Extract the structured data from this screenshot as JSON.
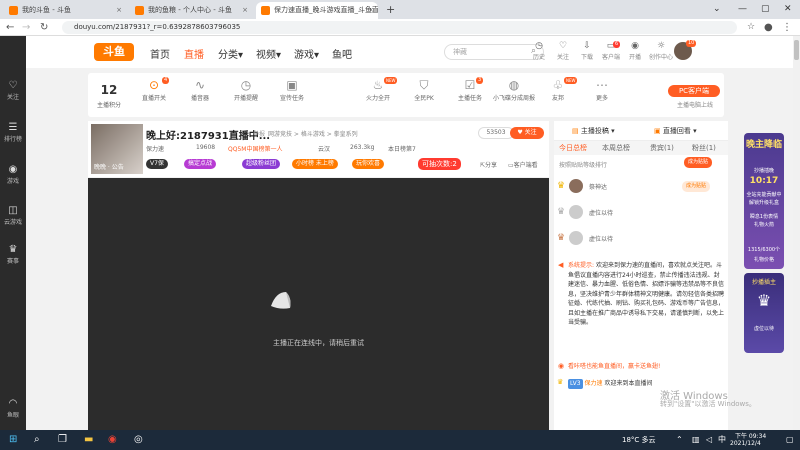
{
  "browser": {
    "tabs": [
      {
        "label": "我的斗鱼 - 斗鱼"
      },
      {
        "label": "我的鱼粮 - 个人中心 - 斗鱼"
      },
      {
        "label": "保力速直播_晚斗游戏直播_斗鱼直"
      }
    ],
    "url": "douyu.com/2187931?_r=0.6392878603796035"
  },
  "sidebar": {
    "items": [
      {
        "label": "关注",
        "icon": "heart-icon"
      },
      {
        "label": "排行榜",
        "icon": "list-icon"
      },
      {
        "label": "游戏",
        "icon": "gamepad-icon"
      },
      {
        "label": "云游戏",
        "icon": "cloud-game-icon"
      },
      {
        "label": "赛事",
        "icon": "trophy-icon"
      },
      {
        "label": "鱼眼",
        "icon": "headset-icon"
      }
    ]
  },
  "header": {
    "logo": "斗鱼",
    "nav": [
      {
        "label": "首页"
      },
      {
        "label": "直播"
      },
      {
        "label": "分类"
      },
      {
        "label": "视频"
      },
      {
        "label": "游戏"
      },
      {
        "label": "鱼吧"
      }
    ],
    "search_placeholder": "神藏",
    "icons": [
      {
        "label": "历史"
      },
      {
        "label": "关注"
      },
      {
        "label": "下载"
      },
      {
        "label": "客户端"
      },
      {
        "label": "开播"
      },
      {
        "label": "创作中心"
      }
    ],
    "notif_badge": "6",
    "avatar_badge": "10"
  },
  "toolbar": {
    "level": "12",
    "level_label": "主播积分",
    "items": [
      {
        "label": "直播开关",
        "badge": "4"
      },
      {
        "label": "播音器"
      },
      {
        "label": "开播提醒"
      },
      {
        "label": "宣传任务"
      },
      {
        "label": "火力全开",
        "badge": "NEW"
      },
      {
        "label": "全民PK"
      },
      {
        "label": "主播任务",
        "badge": "3"
      },
      {
        "label": "小飞碟分成周报"
      },
      {
        "label": "友邦",
        "badge": "NEW"
      },
      {
        "label": "更多"
      }
    ],
    "pc_client": "PC客户端",
    "pc_client_label": "主播电脑上线"
  },
  "anchor": {
    "image_label": "晚晚 · 公告",
    "title": "晚上好:2187931直播中...",
    "report": "举报",
    "crumb": "网游竞技 > 格斗游戏 > 拳皇系列",
    "room_num": "53503",
    "follow": "关注",
    "meta": [
      "保力速",
      "19608",
      "QQ5M中国榜第一人",
      "云汉",
      "263.3kg",
      "本日榜第7"
    ],
    "badges": [
      {
        "label": "V7保",
        "color": "#333333"
      },
      {
        "label": "搞定点战",
        "color": "#b73bd3"
      },
      {
        "label": "超级粉丝团",
        "color": "#8b3bd3"
      },
      {
        "label": "小时榜 未上榜",
        "color": "#ff7a00"
      },
      {
        "label": "玩你欢喜",
        "color": "#ff7a00"
      },
      {
        "label": "可抽次数:2",
        "color": "#ff3b30"
      }
    ],
    "share": "分享",
    "client_watch": "客户端看"
  },
  "video": {
    "loading_text": "主播正在连线中，请稍后重试"
  },
  "chat": {
    "tab_ranking": "主播投稿",
    "tab_replay": "直播回看",
    "subtabs": [
      "今日总榜",
      "本周总榜",
      "贵宾(1)",
      "粉丝(1)"
    ],
    "filter": "按照贴贴等级排行",
    "filter_btn": "成为贴贴",
    "rank": [
      {
        "name": "祭神达",
        "btn": "成为贴贴"
      },
      {
        "name": "虚位以待",
        "btn": "虚位以待"
      },
      {
        "name": "虚位以待"
      },
      {
        "name": "虚位以待"
      }
    ],
    "system_label": "系统提示:",
    "system_msg": "欢迎来到保力速的直播间，喜欢就点关注吧。斗鱼倡议直播内容进行24小时巡查，禁止传播违法违规、封建迷信、暴力血腥、低俗色情、招嫖诈骗等违禁品等不良信息，坚决维护青少年群体精神文明健康。请勿轻信各类招聘征婚、代练代抽、刷钻、购买礼包码、游戏币等广告信息，且如主播在推广商品中诱导私下交易，请谨慎判断，以免上当受骗。",
    "notice_msg": "看咔嗒也能鱼直播间，赢卡送鱼翅!",
    "user_msg_name": "保力速",
    "user_msg_text": "欢迎来到本直播间",
    "user_level": "LV3"
  },
  "promo": {
    "title1": "晚主降临",
    "line1": "抄播插晚",
    "countdown": "10:17",
    "line2": "全站充能贡献中",
    "line3": "解锁升级礼盒",
    "line4": "瞬息1份表情",
    "line5": "礼物火箭",
    "progress": "1315/6300个",
    "line6": "礼物价格",
    "title2": "抄播插主",
    "line7": "虚位以待"
  },
  "watermark": {
    "line1": "激活 Windows",
    "line2": "转到\"设置\"以激活 Windows。"
  },
  "taskbar": {
    "temp": "18°C 多云",
    "time": "下午 09:34",
    "date": "2021/12/4"
  },
  "colors": {
    "accent": "#ff5d23",
    "orange": "#ff7a00"
  }
}
